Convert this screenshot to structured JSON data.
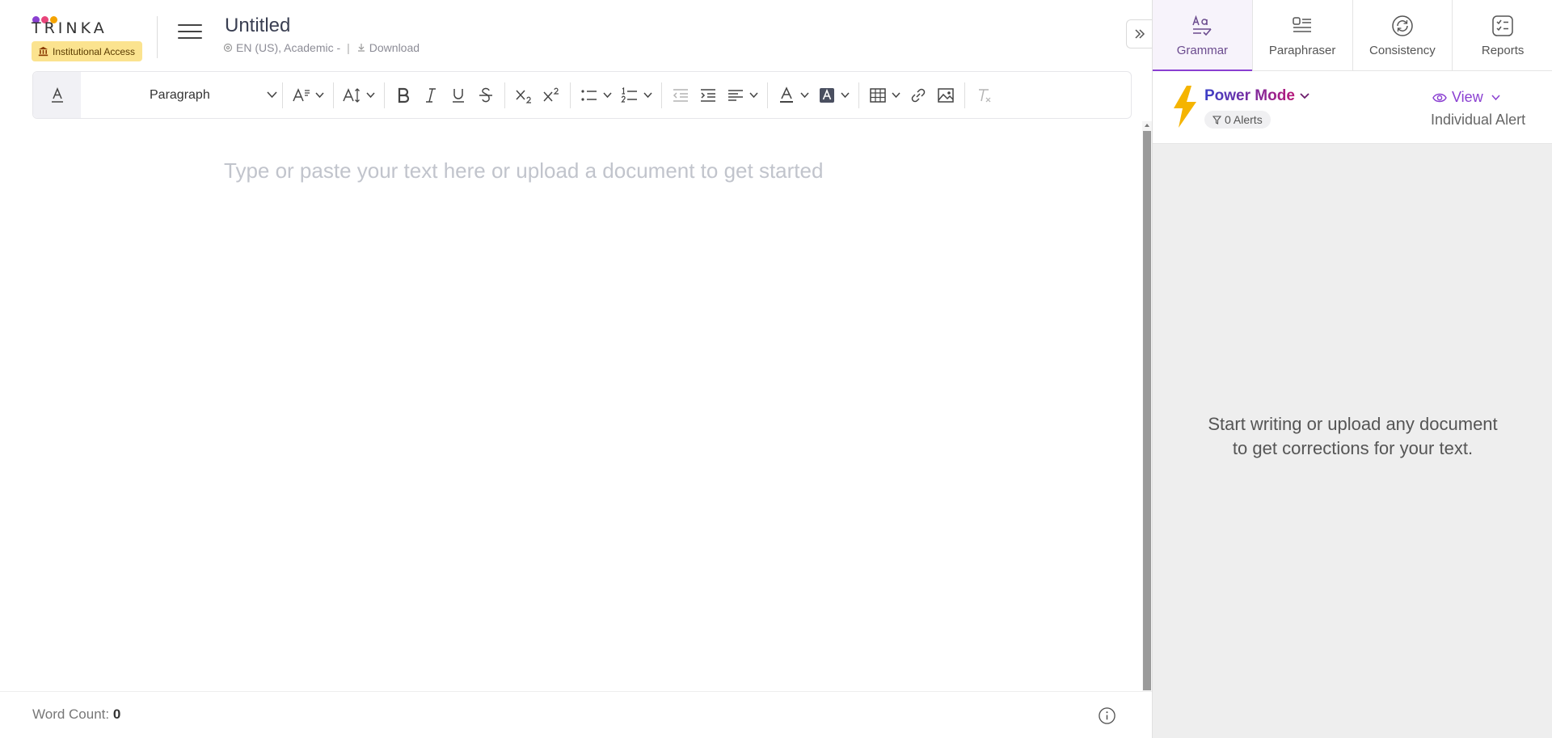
{
  "header": {
    "logo_text": "TRINKA",
    "logo_dot_colors": [
      "#8a3fd1",
      "#e8457a",
      "#f4a300"
    ],
    "institution_badge": "Institutional Access",
    "document_title": "Untitled",
    "language_setting": "EN (US), Academic -",
    "download_label": "Download"
  },
  "toolbar": {
    "paragraph_style": "Paragraph",
    "buttons": [
      "text-format",
      "font-family",
      "font-size",
      "bold",
      "italic",
      "underline",
      "strikethrough",
      "subscript",
      "superscript",
      "bullet-list",
      "numbered-list",
      "outdent",
      "indent",
      "align",
      "text-color",
      "highlight-color",
      "table",
      "link",
      "image",
      "clear-formatting"
    ]
  },
  "editor": {
    "placeholder": "Type or paste your text here or upload a document to get started"
  },
  "footer": {
    "word_count_label": "Word Count:",
    "word_count_value": "0"
  },
  "panel": {
    "tabs": [
      {
        "label": "Grammar",
        "icon": "grammar-icon",
        "active": true
      },
      {
        "label": "Paraphraser",
        "icon": "paraphraser-icon",
        "active": false
      },
      {
        "label": "Consistency",
        "icon": "consistency-icon",
        "active": false
      },
      {
        "label": "Reports",
        "icon": "reports-icon",
        "active": false
      }
    ],
    "mode_label": "Power Mode",
    "alerts_label": "0 Alerts",
    "view_label": "View",
    "view_mode": "Individual Alert",
    "empty_message_line1": "Start writing or upload any document",
    "empty_message_line2": "to get corrections for your text."
  },
  "colors": {
    "accent": "#8a3fd1",
    "badge_bg": "#fbe38f",
    "panel_bg": "#eeeeee",
    "bolt": "#f5b400"
  }
}
